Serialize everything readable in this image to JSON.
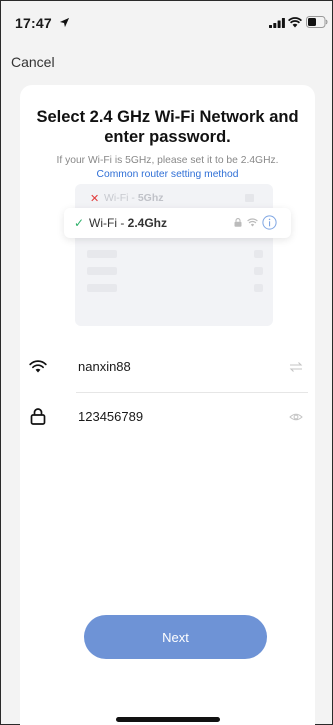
{
  "status_bar": {
    "time": "17:47",
    "icons": [
      "location-arrow-icon",
      "cellular-signal-icon",
      "wifi-icon",
      "battery-icon"
    ]
  },
  "nav": {
    "cancel_label": "Cancel"
  },
  "header": {
    "title": "Select 2.4 GHz Wi-Fi Network and enter password.",
    "subtitle": "If your Wi-Fi is 5GHz, please set it to be 2.4GHz.",
    "link_label": "Common router setting method"
  },
  "illustration": {
    "wrong_prefix": "Wi-Fi - ",
    "wrong_band": "5Ghz",
    "right_prefix": "Wi-Fi - ",
    "right_band": "2.4Ghz"
  },
  "form": {
    "ssid": {
      "value": "nanxin88",
      "icon": "wifi-icon",
      "action_icon": "switch-arrows-icon"
    },
    "password": {
      "value": "123456789",
      "icon": "lock-icon",
      "action_icon": "eye-icon"
    }
  },
  "actions": {
    "next_label": "Next"
  },
  "colors": {
    "accent": "#6e93d6",
    "link": "#2f6fd6",
    "success": "#2fb06a",
    "error": "#e23b3b",
    "background": "#f3f3f3"
  }
}
